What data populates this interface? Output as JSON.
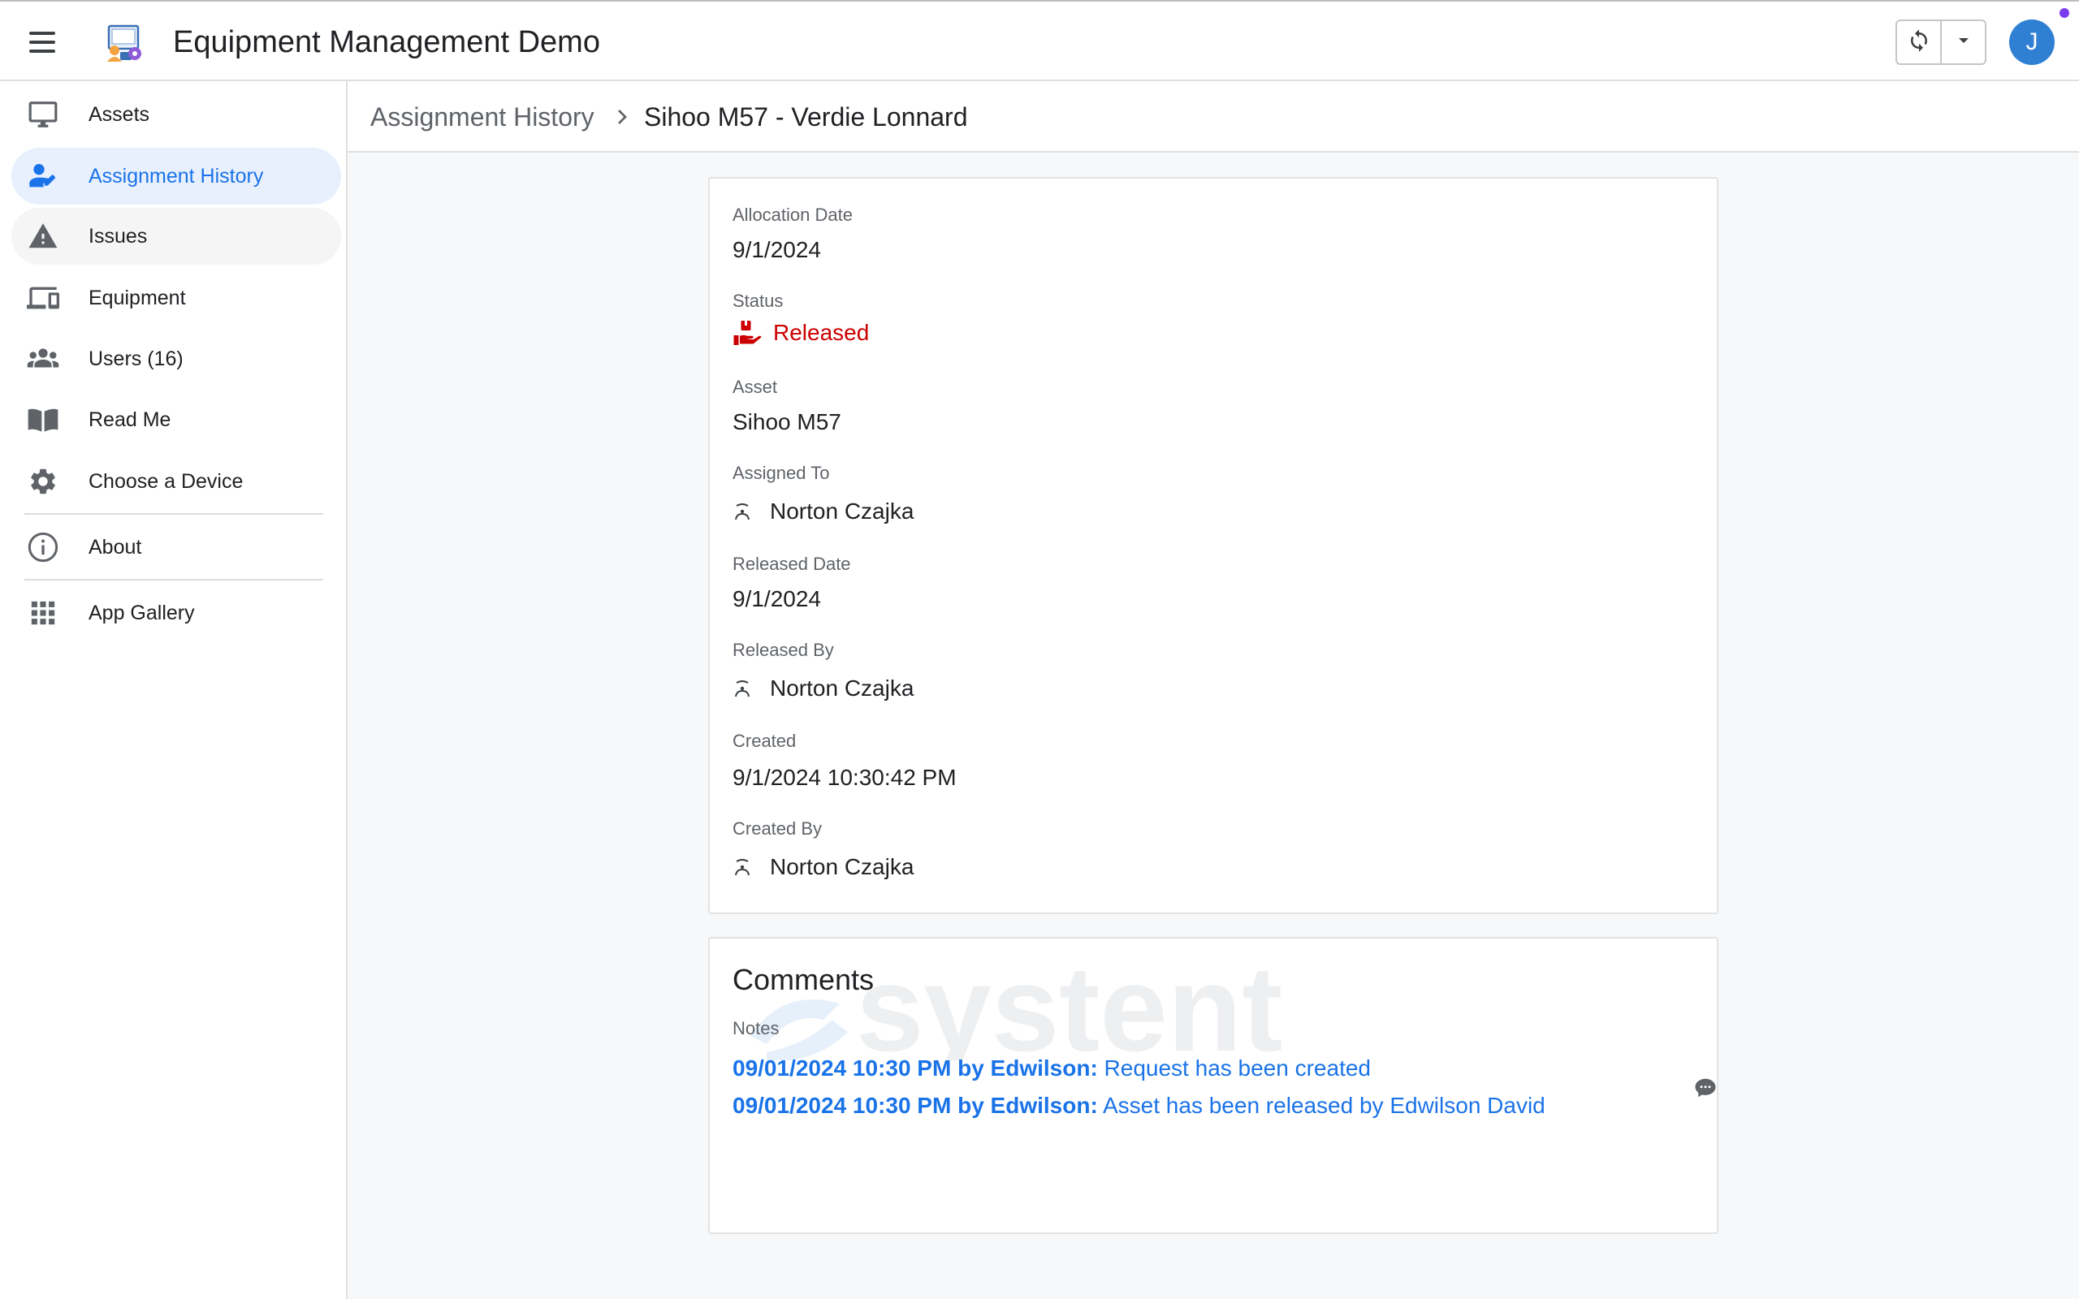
{
  "header": {
    "menu_icon": "hamburger-menu-icon",
    "logo_icon": "equipment-app-logo-icon",
    "title": "Equipment Management Demo",
    "sync_icon": "sync-icon",
    "dropdown_icon": "caret-down-icon",
    "user_initial": "J",
    "avatar_color": "#2f7fd3",
    "notification_color": "#7c3aed"
  },
  "sidebar": {
    "items": [
      {
        "label": "Assets",
        "icon": "monitor-icon"
      },
      {
        "label": "Assignment History",
        "icon": "user-edit-icon",
        "active": true
      },
      {
        "label": "Issues",
        "icon": "warning-icon"
      },
      {
        "label": "Equipment",
        "icon": "devices-icon"
      },
      {
        "label": "Users (16)",
        "icon": "users-icon"
      },
      {
        "label": "Read Me",
        "icon": "book-icon"
      },
      {
        "label": "Choose a Device",
        "icon": "gear-icon"
      },
      {
        "label": "About",
        "icon": "info-icon"
      },
      {
        "label": "App Gallery",
        "icon": "grid-icon"
      }
    ]
  },
  "breadcrumb": {
    "parent": "Assignment History",
    "separator_icon": "chevron-right-icon",
    "current": "Sihoo M57 - Verdie Lonnard"
  },
  "details": {
    "allocation_date_label": "Allocation Date",
    "allocation_date": "9/1/2024",
    "status_label": "Status",
    "status": "Released",
    "status_icon": "hand-box-icon",
    "status_color": "#cc0000",
    "asset_label": "Asset",
    "asset": "Sihoo M57",
    "assigned_to_label": "Assigned To",
    "assigned_to": "Norton Czajka",
    "released_date_label": "Released Date",
    "released_date": "9/1/2024",
    "released_by_label": "Released By",
    "released_by": "Norton Czajka",
    "created_label": "Created",
    "created": "9/1/2024 10:30:42 PM",
    "created_by_label": "Created By",
    "created_by": "Norton Czajka",
    "person_icon": "user-avatar-icon"
  },
  "comments": {
    "title": "Comments",
    "notes_label": "Notes",
    "watermark": "systent",
    "entries": [
      {
        "meta": "09/01/2024 10:30 PM by Edwilson:",
        "text": "Request has been created"
      },
      {
        "meta": "09/01/2024 10:30 PM by Edwilson:",
        "text": "Asset has been released by Edwilson David"
      }
    ],
    "comment_icon": "chat-bubble-icon",
    "link_color": "#1a73e8"
  }
}
